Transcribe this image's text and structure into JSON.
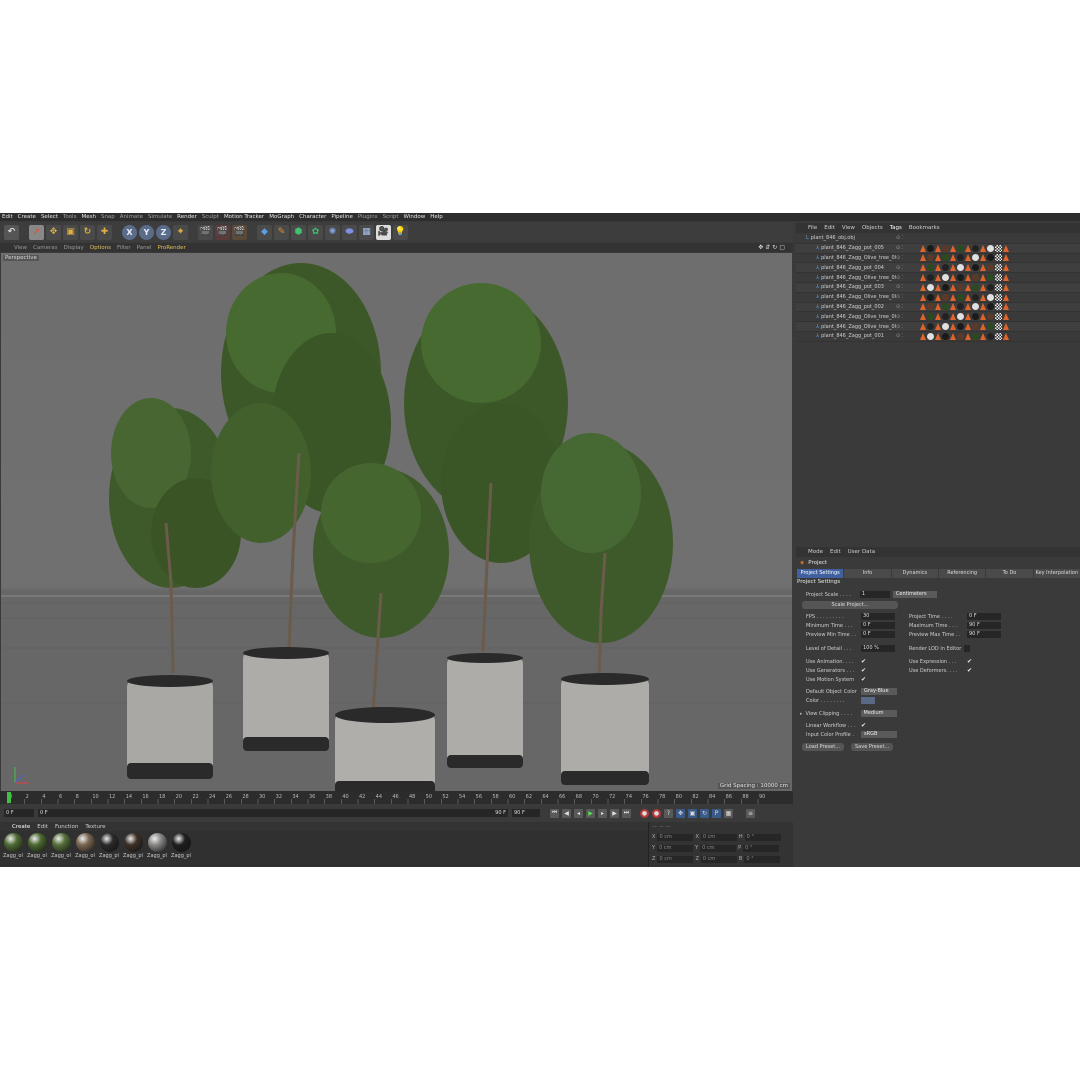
{
  "menubar": [
    "Edit",
    "Create",
    "Select",
    "Tools",
    "Mesh",
    "Snap",
    "Animate",
    "Simulate",
    "Render",
    "Sculpt",
    "Motion Tracker",
    "MoGraph",
    "Character",
    "Pipeline",
    "Plugins",
    "Script",
    "Window",
    "Help"
  ],
  "toolbar": {
    "axis_x": "X",
    "axis_y": "Y",
    "axis_z": "Z"
  },
  "viewport": {
    "menu": [
      "View",
      "Cameras",
      "Display",
      "Options",
      "Filter",
      "Panel",
      "ProRender"
    ],
    "label": "Perspective",
    "grid_spacing": "Grid Spacing : 10000 cm"
  },
  "timeline": {
    "ticks": [
      "0",
      "2",
      "4",
      "6",
      "8",
      "10",
      "12",
      "14",
      "16",
      "18",
      "20",
      "22",
      "24",
      "26",
      "28",
      "30",
      "32",
      "34",
      "36",
      "38",
      "40",
      "42",
      "44",
      "46",
      "48",
      "50",
      "52",
      "54",
      "56",
      "58",
      "60",
      "62",
      "64",
      "66",
      "68",
      "70",
      "72",
      "74",
      "76",
      "78",
      "80",
      "82",
      "84",
      "86",
      "88",
      "90"
    ],
    "current_frame": "0 F",
    "start_frame": "0 F",
    "end_frame": "90 F",
    "end_frame_2": "90 F",
    "min_marker": "0 F",
    "max_marker": "90 F"
  },
  "materials": {
    "menu": [
      "Create",
      "Edit",
      "Function",
      "Texture"
    ],
    "items": [
      {
        "label": "Zagg_ol",
        "color": "#4f6b34"
      },
      {
        "label": "Zagg_ol",
        "color": "#4b6a30"
      },
      {
        "label": "Zagg_ol",
        "color": "#56703a"
      },
      {
        "label": "Zagg_ol",
        "color": "#7a6650"
      },
      {
        "label": "Zagg_pl",
        "color": "#2a2a2a"
      },
      {
        "label": "Zagg_pl",
        "color": "#3d3026"
      },
      {
        "label": "Zagg_pl",
        "color": "#8a8886"
      },
      {
        "label": "Zagg_pl",
        "color": "#1f1f1f"
      }
    ]
  },
  "coords": {
    "rows": [
      {
        "axis": "X",
        "v1": "0 cm",
        "ax2": "X",
        "v2": "0 cm",
        "ax3": "H",
        "v3": "0 °"
      },
      {
        "axis": "Y",
        "v1": "0 cm",
        "ax2": "Y",
        "v2": "0 cm",
        "ax3": "P",
        "v3": "0 °"
      },
      {
        "axis": "Z",
        "v1": "0 cm",
        "ax2": "Z",
        "v2": "0 cm",
        "ax3": "B",
        "v3": "0 °"
      }
    ]
  },
  "object_manager": {
    "menu": [
      "File",
      "Edit",
      "View",
      "Objects",
      "Tags",
      "Bookmarks"
    ],
    "root": "plant_846_obj.obj",
    "objects": [
      "plant_846_Zagg_pot_005",
      "plant_846_Zagg_Olive_tree_005",
      "plant_846_Zagg_pot_004",
      "plant_846_Zagg_Olive_tree_004",
      "plant_846_Zagg_pot_003",
      "plant_846_Zagg_Olive_tree_003",
      "plant_846_Zagg_pot_002",
      "plant_846_Zagg_Olive_tree_002",
      "plant_846_Zagg_Olive_tree_001",
      "plant_846_Zagg_pot_001"
    ],
    "tag_colors": [
      "#e0642a",
      "#1a1a1a",
      "#5a3a2a",
      "#2a4a20",
      "#222222",
      "#e0e0e0",
      "#c05020"
    ]
  },
  "attributes": {
    "menu": [
      "Mode",
      "Edit",
      "User Data"
    ],
    "title": "Project",
    "tabs": [
      "Project Settings",
      "Info",
      "Dynamics",
      "Referencing",
      "To Do",
      "Key Interpolation"
    ],
    "section": "Project Settings",
    "project_scale_label": "Project Scale . . . .",
    "project_scale_value": "1",
    "project_scale_unit": "Centimeters",
    "scale_project_btn": "Scale Project...",
    "fps_label": "FPS . . . . . . . . .",
    "fps_value": "30",
    "project_time_label": "Project Time . . . .",
    "project_time_value": "0 F",
    "min_time_label": "Minimum Time . . .",
    "min_time_value": "0 F",
    "max_time_label": "Maximum Time . . .",
    "max_time_value": "90 F",
    "prev_min_label": "Preview Min Time . .",
    "prev_min_value": "0 F",
    "prev_max_label": "Preview Max Time . .",
    "prev_max_value": "90 F",
    "lod_label": "Level of Detail . . .",
    "lod_value": "100 %",
    "render_lod_label": "Render LOD in Editor",
    "use_anim_label": "Use Animation. . . .",
    "use_expr_label": "Use Expression . . .",
    "use_gen_label": "Use Generators . . .",
    "use_def_label": "Use Deformers. . . .",
    "use_motion_label": "Use Motion System",
    "default_color_label": "Default Object Color",
    "default_color_value": "Gray-Blue",
    "color_label": "Color . . . . . . . .",
    "view_clipping_label": "View Clipping . . . .",
    "view_clipping_value": "Medium",
    "linear_wf_label": "Linear Workflow . . .",
    "input_profile_label": "Input Color Profile .",
    "input_profile_value": "sRGB",
    "load_preset": "Load Preset...",
    "save_preset": "Save Preset..."
  }
}
